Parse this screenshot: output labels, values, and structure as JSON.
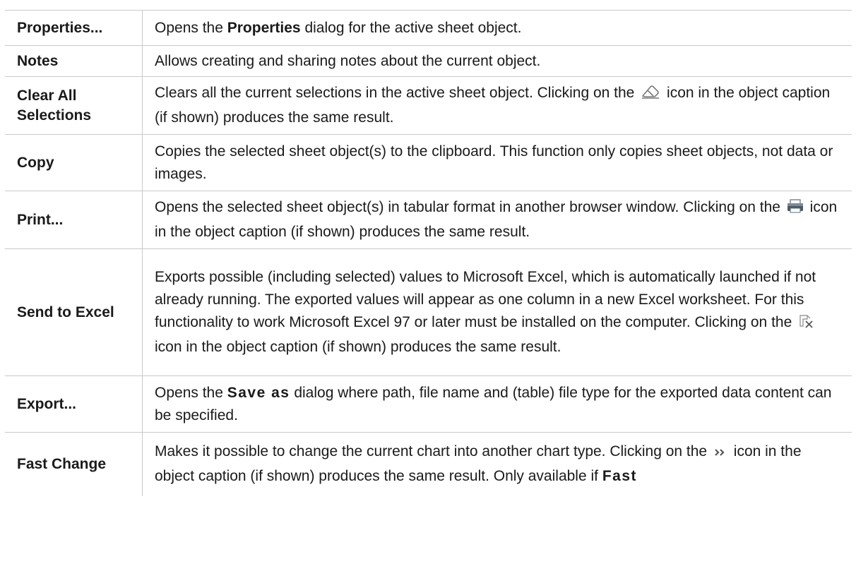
{
  "rows": [
    {
      "command": "Properties...",
      "desc_parts": [
        {
          "t": "Opens the "
        },
        {
          "t": "Properties",
          "b": 1
        },
        {
          "t": " dialog for the active sheet object."
        }
      ],
      "height": 50
    },
    {
      "command": "Notes",
      "desc_parts": [
        {
          "t": "Allows creating and sharing notes about the current object."
        }
      ],
      "height": 44
    },
    {
      "command": "Clear All Selections",
      "desc_parts": [
        {
          "t": "Clears all the current selections in the active sheet object. Clicking on the "
        },
        {
          "icon": "eraser-icon"
        },
        {
          "t": " icon in the object caption (if shown) produces the same result."
        }
      ],
      "height": 82
    },
    {
      "command": "Copy",
      "desc_parts": [
        {
          "t": "Copies the selected sheet object(s) to the clipboard. This function only copies sheet objects, not data or images."
        }
      ],
      "height": 80
    },
    {
      "command": "Print...",
      "desc_parts": [
        {
          "t": "Opens the selected sheet object(s) in tabular format in another browser window. Clicking on the "
        },
        {
          "icon": "printer-icon"
        },
        {
          "t": " icon in the object caption (if shown) produces the same result."
        }
      ],
      "height": 82
    },
    {
      "command": "Send to Excel",
      "desc_parts": [
        {
          "t": "Exports possible (including selected) values to Microsoft Excel, which is automatically launched if not already running. The exported values will appear as one column in a new Excel worksheet. For this functionality to work Microsoft Excel 97 or later must be installed on the computer. Clicking on the "
        },
        {
          "icon": "excel-export-icon"
        },
        {
          "t": " icon in the object caption (if shown) produces the same result."
        }
      ],
      "height": 180
    },
    {
      "command": "Export...",
      "desc_parts": [
        {
          "t": "Opens the "
        },
        {
          "t": "Save as",
          "b": 1,
          "wide": 1
        },
        {
          "t": " dialog where path, file name and (table) file type for the exported data content can be specified."
        }
      ],
      "height": 80
    },
    {
      "command": "Fast Change",
      "desc_parts": [
        {
          "t": "Makes it possible to change the current chart into another chart type. Clicking on the "
        },
        {
          "icon": "fast-change-icon"
        },
        {
          "t": " icon in the object caption (if shown) produces the same result. Only available if "
        },
        {
          "t": "Fast",
          "b": 1,
          "wide": 1
        }
      ],
      "height": 90
    }
  ]
}
